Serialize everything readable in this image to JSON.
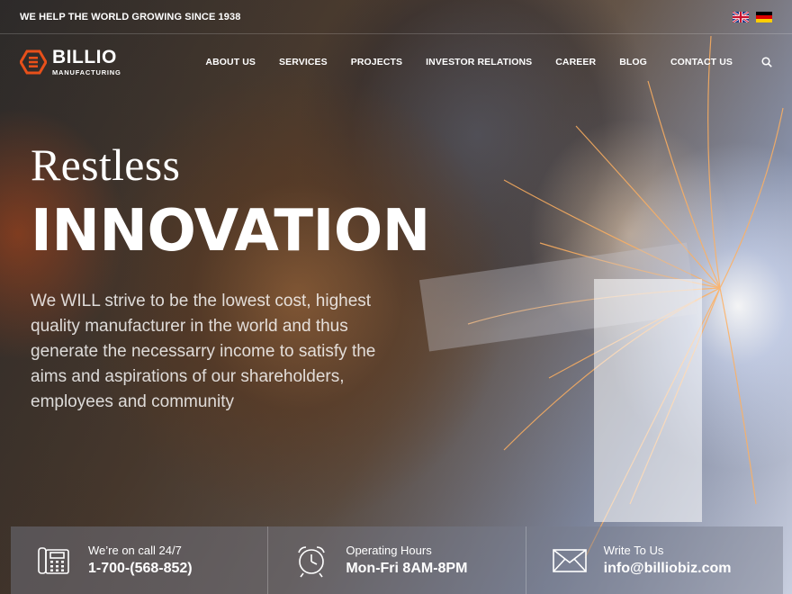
{
  "topbar": {
    "tagline": "WE HELP THE WORLD GROWING SINCE 1938",
    "flags": [
      {
        "name": "uk-flag-icon"
      },
      {
        "name": "germany-flag-icon"
      }
    ]
  },
  "header": {
    "logo": {
      "name": "BILLIO",
      "sub": "MANUFACTURING",
      "accent": "#e8501a"
    },
    "nav": [
      {
        "label": "ABOUT US"
      },
      {
        "label": "SERVICES"
      },
      {
        "label": "PROJECTS"
      },
      {
        "label": "INVESTOR RELATIONS"
      },
      {
        "label": "CAREER"
      },
      {
        "label": "BLOG"
      },
      {
        "label": "CONTACT US"
      }
    ],
    "search_icon": "search-icon"
  },
  "hero": {
    "script": "Restless",
    "title": "INNOVATION",
    "description": "We WILL strive to be the lowest cost, highest quality manufacturer in the world and thus generate the necessarry income to satisfy the aims and aspirations of our shareholders, employees and community"
  },
  "contacts": [
    {
      "icon": "phone-icon",
      "label": "We’re on call 24/7",
      "value": "1-700-(568-852)"
    },
    {
      "icon": "alarm-clock-icon",
      "label": "Operating Hours",
      "value": "Mon-Fri 8AM-8PM"
    },
    {
      "icon": "envelope-icon",
      "label": "Write To Us",
      "value": "info@billiobiz.com"
    }
  ]
}
